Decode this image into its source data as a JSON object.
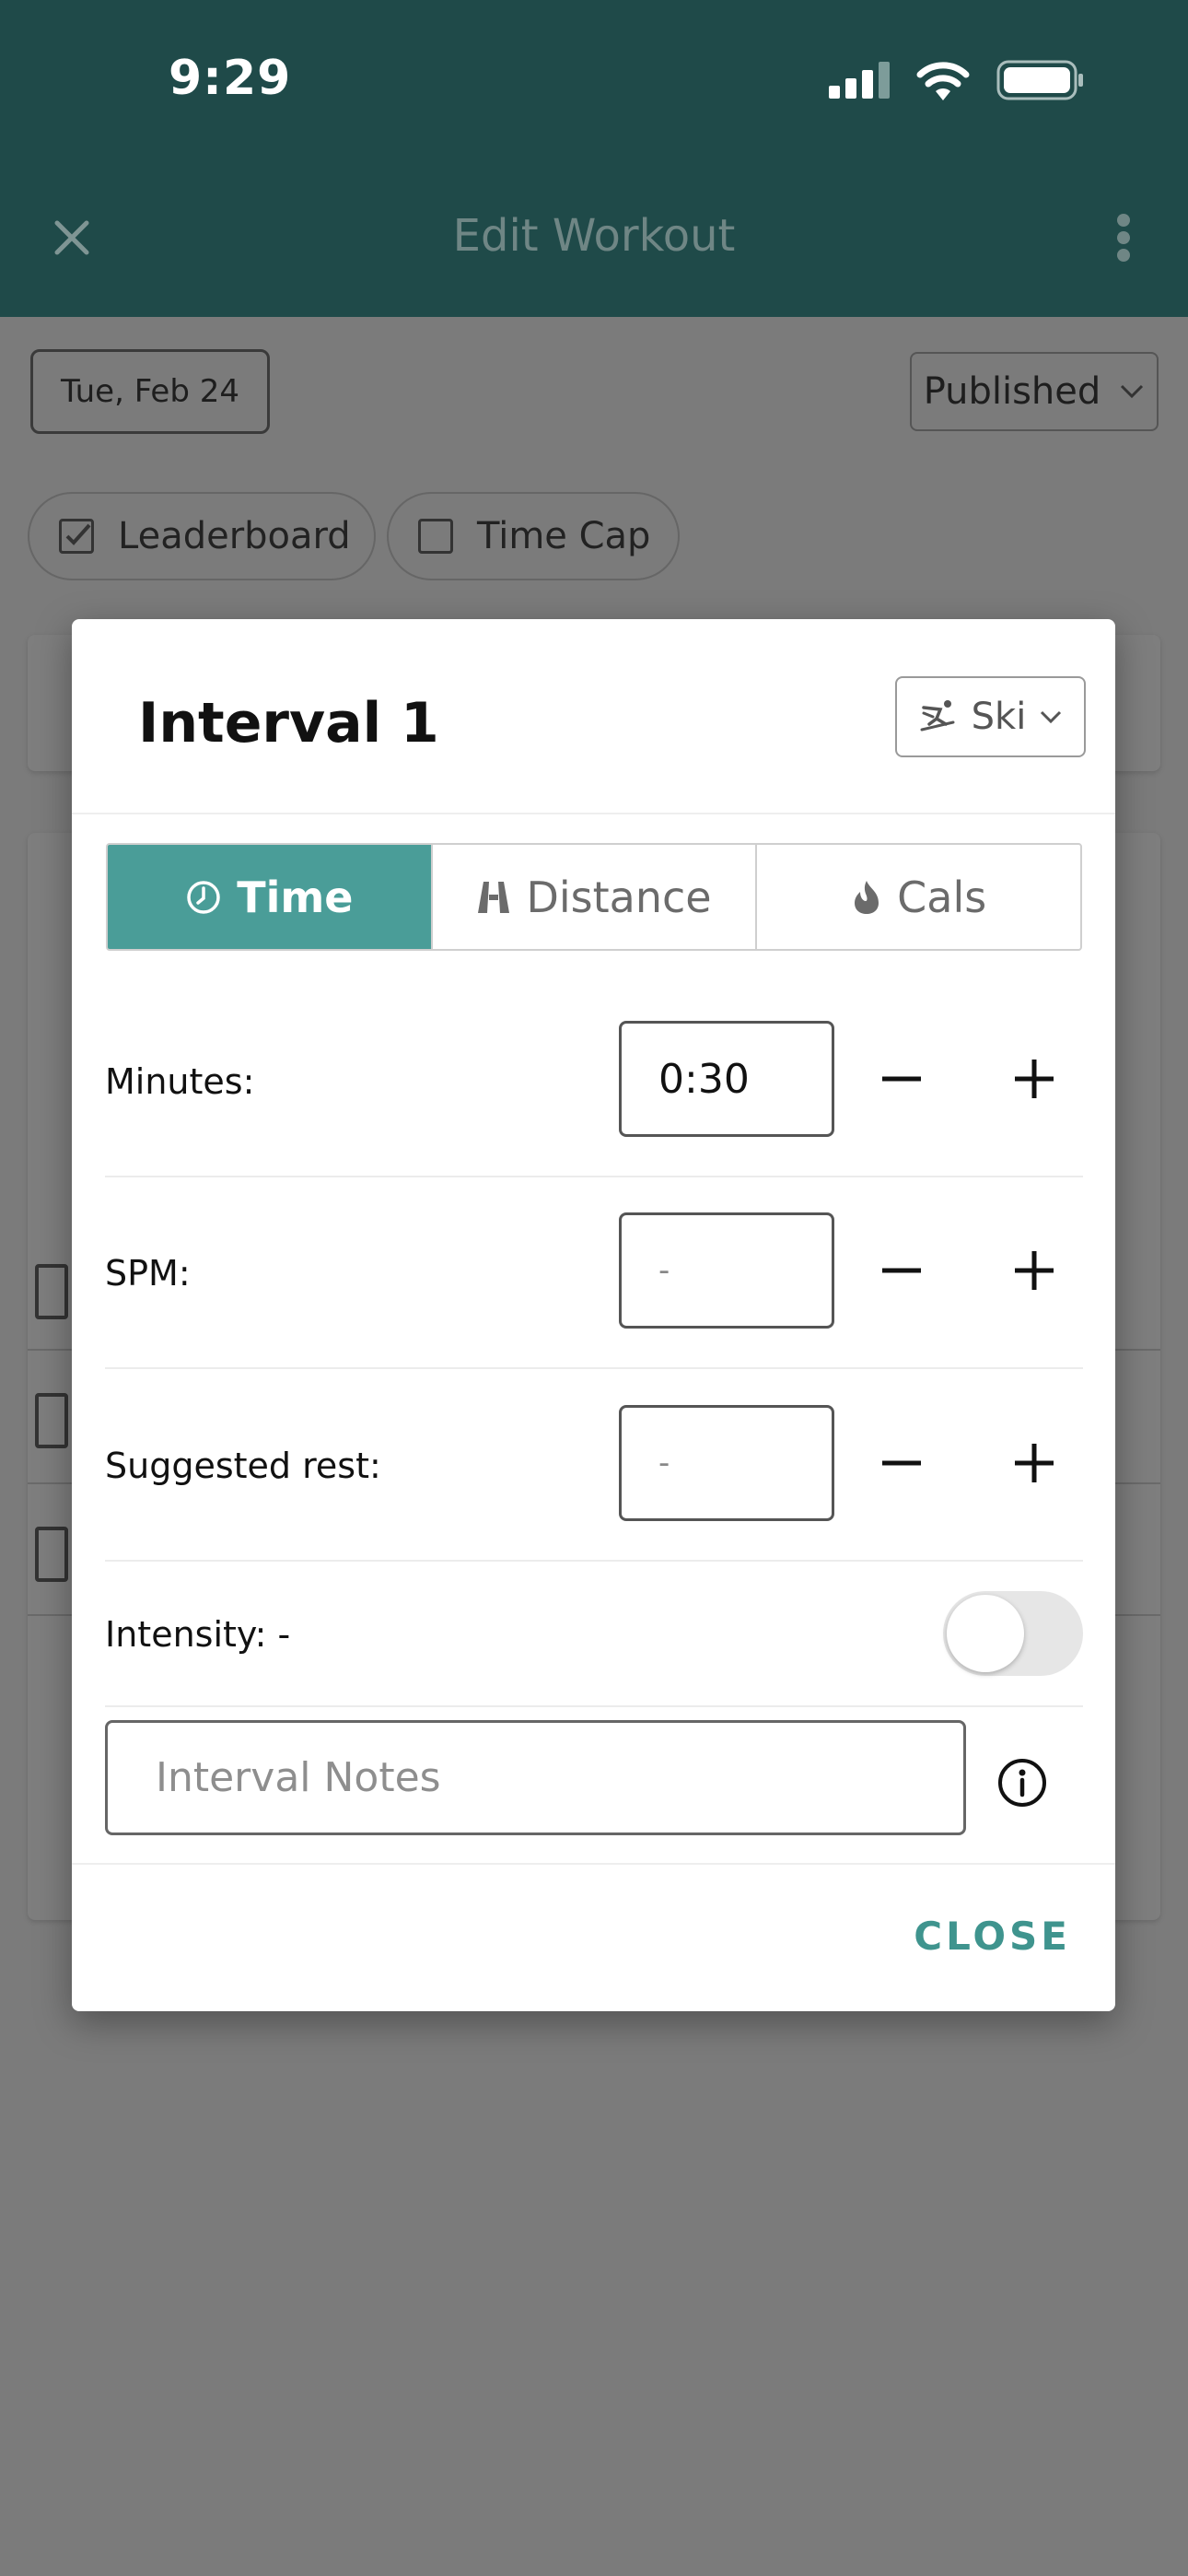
{
  "status_bar": {
    "time": "9:29"
  },
  "nav": {
    "title": "Edit Workout"
  },
  "page": {
    "date": "Tue, Feb 24",
    "status_select": "Published",
    "options": [
      {
        "label": "Leaderboard",
        "checked": true
      },
      {
        "label": "Time Cap",
        "checked": false
      }
    ]
  },
  "modal": {
    "title": "Interval 1",
    "sport_select": "Ski",
    "tabs": [
      {
        "label": "Time",
        "icon": "clock-icon",
        "active": true
      },
      {
        "label": "Distance",
        "icon": "road-icon",
        "active": false
      },
      {
        "label": "Cals",
        "icon": "flame-icon",
        "active": false
      }
    ],
    "fields": [
      {
        "label": "Minutes:",
        "value": "0:30",
        "placeholder": ""
      },
      {
        "label": "SPM:",
        "value": "",
        "placeholder": "-"
      },
      {
        "label": "Suggested rest:",
        "value": "",
        "placeholder": "-"
      }
    ],
    "intensity": {
      "label": "Intensity: -",
      "enabled": false
    },
    "notes_placeholder": "Interval Notes",
    "close_label": "CLOSE"
  },
  "colors": {
    "header": "#1f4a49",
    "accent": "#4a9d98",
    "close": "#3f948e"
  }
}
